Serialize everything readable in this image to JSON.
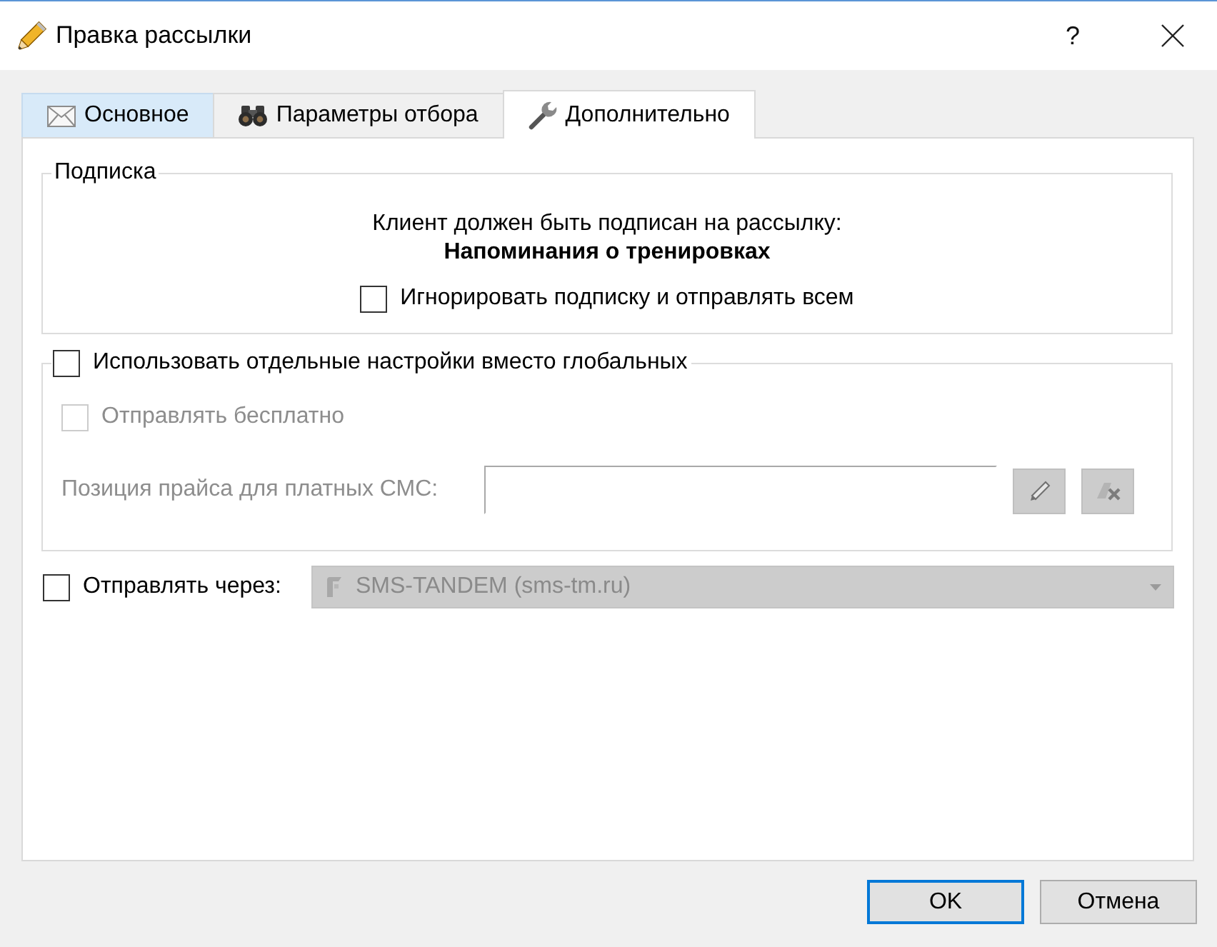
{
  "window": {
    "title": "Правка рассылки",
    "help_button": "?"
  },
  "tabs": [
    {
      "label": "Основное",
      "selected": false,
      "hovered": true
    },
    {
      "label": "Параметры отбора",
      "selected": false,
      "hovered": false
    },
    {
      "label": "Дополнительно",
      "selected": true,
      "hovered": false
    }
  ],
  "subscription": {
    "title": "Подписка",
    "message": "Клиент должен быть подписан на рассылку:",
    "mailing": "Напоминания о тренировках",
    "ignore_subscription": {
      "label": "Игнорировать подписку и отправлять всем",
      "checked": false
    }
  },
  "custom_settings": {
    "use_custom": {
      "label": "Использовать отдельные настройки вместо глобальных",
      "checked": false
    },
    "send_free": {
      "label": "Отправлять бесплатно",
      "checked": false,
      "disabled": true
    },
    "price_position": {
      "label": "Позиция прайса для платных СМС:",
      "disabled": true
    }
  },
  "send_via": {
    "checkbox": {
      "label": "Отправлять через:",
      "checked": false
    },
    "provider": {
      "value": "SMS-TANDEM (sms-tm.ru)",
      "disabled": true
    }
  },
  "buttons": [
    {
      "label": "OK",
      "default": true
    },
    {
      "label": "Отмена",
      "default": false
    }
  ]
}
